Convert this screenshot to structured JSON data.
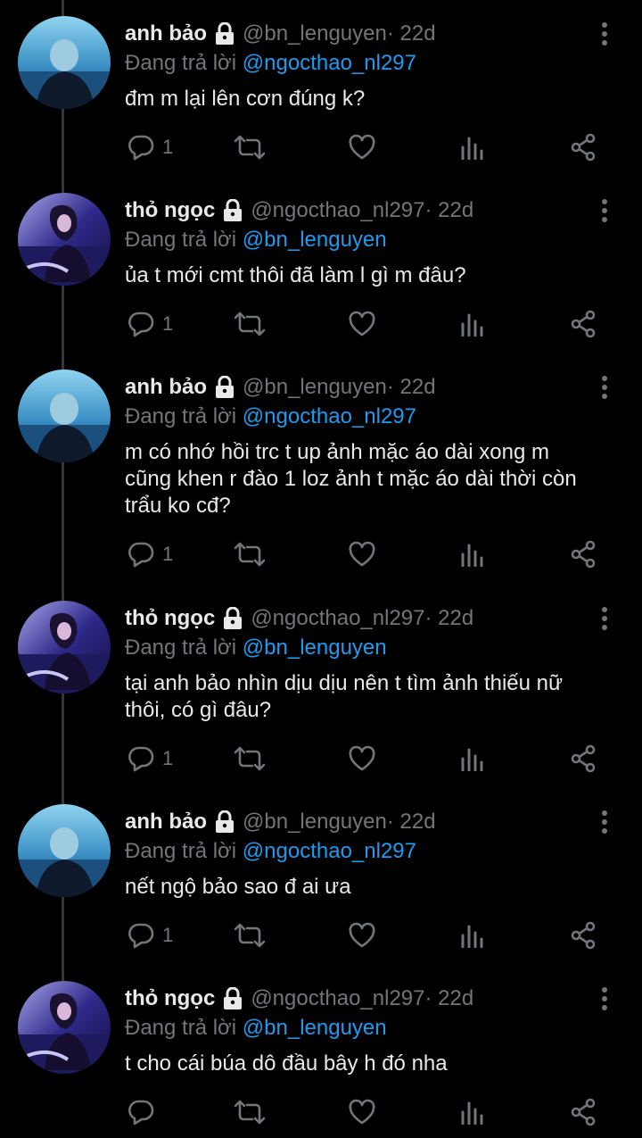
{
  "colors": {
    "background": "#000000",
    "text": "#e7e9ea",
    "secondary": "#71767b",
    "mention": "#1d9bf0",
    "thread_line": "#333639"
  },
  "reply_prefix": "Đang trả lời",
  "tweets": [
    {
      "name": "anh bảo",
      "handle": "@bn_lenguyen",
      "time": "· 22d",
      "reply_to": "@ngocthao_nl297",
      "text": "đm m lại lên cơn đúng k?",
      "reply_count": "1",
      "avatar": "avatar-anh-bao"
    },
    {
      "name": "thỏ ngọc",
      "handle": "@ngocthao_nl297",
      "time": "· 22d",
      "reply_to": "@bn_lenguyen",
      "text": "ủa t mới cmt thôi đã làm l gì m đâu?",
      "reply_count": "1",
      "avatar": "avatar-tho-ngoc"
    },
    {
      "name": "anh bảo",
      "handle": "@bn_lenguyen",
      "time": "· 22d",
      "reply_to": "@ngocthao_nl297",
      "text": "m có nhớ hồi trc t up ảnh mặc áo dài xong m cũng khen r đào 1 loz ảnh t mặc áo dài thời còn trẩu ko cđ?",
      "reply_count": "1",
      "avatar": "avatar-anh-bao"
    },
    {
      "name": "thỏ ngọc",
      "handle": "@ngocthao_nl297",
      "time": "· 22d",
      "reply_to": "@bn_lenguyen",
      "text": "tại anh bảo nhìn dịu dịu nên t tìm ảnh thiếu nữ thôi, có gì đâu?",
      "reply_count": "1",
      "avatar": "avatar-tho-ngoc"
    },
    {
      "name": "anh bảo",
      "handle": "@bn_lenguyen",
      "time": "· 22d",
      "reply_to": "@ngocthao_nl297",
      "text": "nết ngộ bảo sao đ ai ưa",
      "reply_count": "1",
      "avatar": "avatar-anh-bao"
    },
    {
      "name": "thỏ ngọc",
      "handle": "@ngocthao_nl297",
      "time": "· 22d",
      "reply_to": "@bn_lenguyen",
      "text": "t cho cái búa dô đầu bây h đó nha",
      "reply_count": "",
      "avatar": "avatar-tho-ngoc"
    }
  ],
  "icons": [
    "lock-icon",
    "more-options-icon",
    "reply-icon",
    "retweet-icon",
    "like-icon",
    "views-icon",
    "share-icon"
  ]
}
